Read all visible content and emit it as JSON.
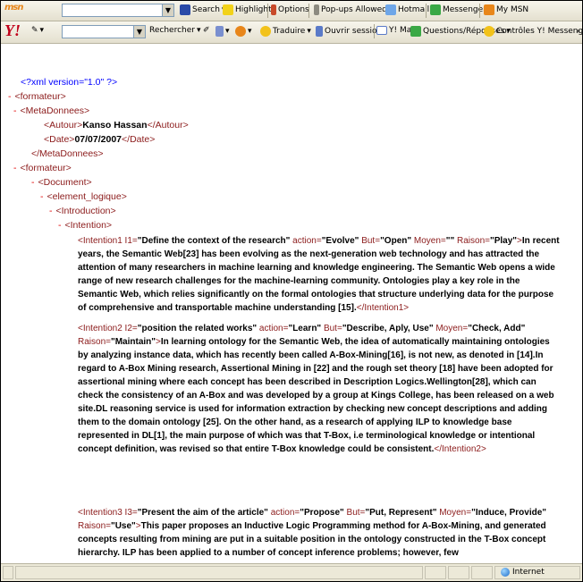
{
  "toolbar1": {
    "logo": "msn",
    "search": "Search",
    "highlight": "Highlight",
    "options": "Options",
    "popups": "Pop-ups Allowed",
    "hotmail": "Hotmail",
    "messenger": "Messenger",
    "mymsn": "My MSN"
  },
  "toolbar2": {
    "logo": "Y!",
    "rechercher": "Rechercher",
    "traduire": "Traduire",
    "ouvrir": "Ouvrir session",
    "ymail": "Y! Mail",
    "questions": "Questions/Réponses",
    "controles": "Contrôles Y! Messenger"
  },
  "xml": {
    "decl": "<?xml version=\"1.0\" ?>",
    "formateur_open": "<formateur>",
    "meta_open": "<MetaDonnees>",
    "autor_open": "<Autour>",
    "autor_val": "Kanso Hassan",
    "autor_close": "</Autour>",
    "date_open": "<Date>",
    "date_val": "07/07/2007",
    "date_close": "</Date>",
    "meta_close": "</MetaDonnees>",
    "formateur2_open": "<formateur>",
    "document_open": "<Document>",
    "element_open": "<element_logique>",
    "intro_open": "<Introduction>",
    "intention_open": "<Intention>",
    "i1_tag": "<Intention1 I1=",
    "i1_i1": "\"Define the context of the research\"",
    "i1_action_k": " action=",
    "i1_action": "\"Evolve\"",
    "i1_but_k": " But=",
    "i1_but": "\"Open\"",
    "i1_moyen_k": " Moyen=",
    "i1_moyen": "\"\"",
    "i1_raison_k": " Raison=",
    "i1_raison": "\"Play\"",
    "i1_close_bracket": ">",
    "i1_first": "In",
    "i1_text": "recent years, the Semantic Web[23] has been evolving as the next-generation web technology and has attracted the attention of many researchers in machine learning and knowledge engineering. The Semantic Web opens a wide range of new research challenges for the machine-learning community. Ontologies play a key role in the Semantic Web, which relies significantly on the formal ontologies that structure underlying data for the purpose of comprehensive and transportable machine understanding [15].",
    "i1_close": "</Intention1>",
    "i2_tag": "<Intention2 I2=",
    "i2_i2": "\"position the related works\"",
    "i2_action_k": " action=",
    "i2_action": "\"Learn\"",
    "i2_but_k": " But=",
    "i2_but": "\"Describe, Aply, Use\"",
    "i2_moyen_k": " Moyen=",
    "i2_moyen": "\"Check, Add\"",
    "i2_raison_k": "Raison=",
    "i2_raison": "\"Maintain\"",
    "i2_text": "In learning ontology for the Semantic Web, the idea of automatically maintaining ontologies by analyzing instance data, which has recently been called A-Box-Mining[16], is not new, as denoted in [14].In regard to A-Box Mining research, Assertional Mining in [22] and the rough set theory [18] have been adopted for assertional mining where each concept has been described in Description Logics.Wellington[28], which can check the consistency of an A-Box and was developed by a group at Kings College, has been released on a web site.DL reasoning service is used for information extraction by checking new concept descriptions and adding them to the domain ontology [25]. On the other hand, as a research of applying ILP to knowledge base represented in DL[1], the main purpose of which was that T-Box, i.e terminological knowledge or intentional concept definition, was revised so that entire T-Box knowledge could be consistent.",
    "i2_close": "</Intention2>",
    "i3_tag": "<Intention3 I3=",
    "i3_i3": "\"Present the aim of the article\"",
    "i3_action_k": " action=",
    "i3_action": "\"Propose\"",
    "i3_but_k": " But=",
    "i3_but": "\"Put, Represent\"",
    "i3_moyen_k": " Moyen=",
    "i3_moyen": "\"Induce, Provide\"",
    "i3_raison_k": "Raison=",
    "i3_raison": "\"Use\"",
    "i3_text": "This paper proposes an Inductive Logic Programming method for A-Box-Mining, and generated concepts resulting from mining are put in a suitable position in the ontology constructed in the T-Box concept hierarchy. ILP has been applied to a number of concept inference problems; however, few"
  },
  "status": {
    "zone": "Internet"
  }
}
